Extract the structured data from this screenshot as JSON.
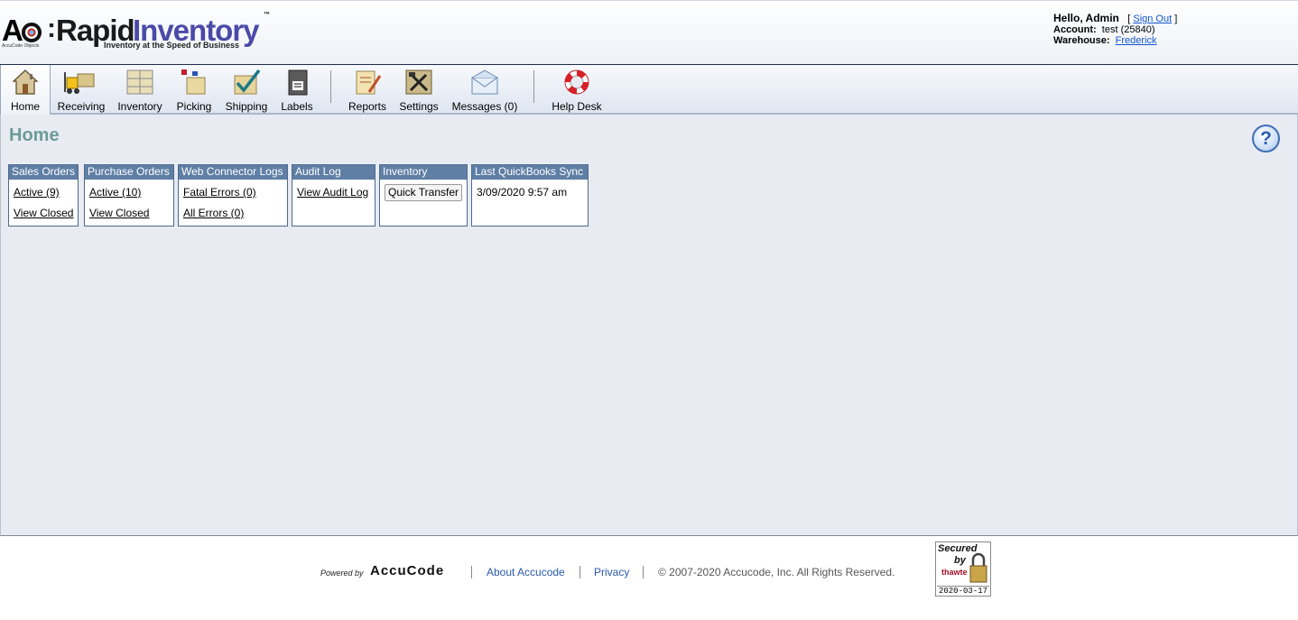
{
  "brand": {
    "ao": "AO",
    "rapid": "Rapid",
    "inventory": "Inventory",
    "tm": "™",
    "tagline": "Inventory at the Speed of Business",
    "sub": "AccuCode Objects"
  },
  "user": {
    "hello": "Hello, Admin",
    "signout_open": "[",
    "signout": "Sign Out",
    "signout_close": "]",
    "account_label": "Account:",
    "account_value": "test (25840)",
    "warehouse_label": "Warehouse:",
    "warehouse_value": "Frederick"
  },
  "toolbar": {
    "items": [
      {
        "label": "Home",
        "icon": "house-icon",
        "active": true
      },
      {
        "label": "Receiving",
        "icon": "forklift-icon"
      },
      {
        "label": "Inventory",
        "icon": "shelves-icon"
      },
      {
        "label": "Picking",
        "icon": "box-icon"
      },
      {
        "label": "Shipping",
        "icon": "checked-box-icon"
      },
      {
        "label": "Labels",
        "icon": "printer-icon"
      },
      {
        "label": "Reports",
        "icon": "report-icon"
      },
      {
        "label": "Settings",
        "icon": "tools-icon"
      },
      {
        "label": "Messages (0)",
        "icon": "envelope-icon"
      },
      {
        "label": "Help Desk",
        "icon": "lifebuoy-icon"
      }
    ]
  },
  "main": {
    "title": "Home",
    "help": "?",
    "panels": {
      "sales": {
        "header": "Sales Orders",
        "link1": "Active (9)",
        "link2": "View Closed"
      },
      "purchase": {
        "header": "Purchase Orders",
        "link1": "Active (10)",
        "link2": "View Closed"
      },
      "webconn": {
        "header": "Web Connector Logs",
        "link1": "Fatal Errors (0)",
        "link2": "All Errors (0)"
      },
      "audit": {
        "header": "Audit Log",
        "link1": "View Audit Log"
      },
      "inventory": {
        "header": "Inventory",
        "button": "Quick Transfer"
      },
      "qbsync": {
        "header": "Last QuickBooks Sync",
        "value": "3/09/2020 9:57 am"
      }
    }
  },
  "footer": {
    "powered": "Powered by",
    "accucode": "AccuCode",
    "about": "About Accucode",
    "privacy": "Privacy",
    "copyright": "© 2007-2020 Accucode, Inc. All Rights Reserved.",
    "seal_secured": "Secured",
    "seal_by": "by",
    "seal_thawte": "thawte",
    "seal_date": "2020-03-17"
  },
  "colors": {
    "title": "#6e9a9a",
    "panel_header": "#5f7fa5",
    "link": "#1155cc",
    "main_bg": "#e8ecf2"
  }
}
